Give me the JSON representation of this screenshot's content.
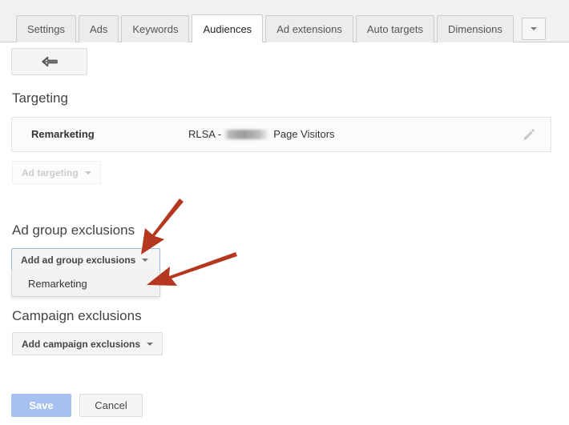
{
  "tabbar": {
    "tabs": [
      {
        "label": "Settings",
        "active": false
      },
      {
        "label": "Ads",
        "active": false
      },
      {
        "label": "Keywords",
        "active": false
      },
      {
        "label": "Audiences",
        "active": true
      },
      {
        "label": "Ad extensions",
        "active": false
      },
      {
        "label": "Auto targets",
        "active": false
      },
      {
        "label": "Dimensions",
        "active": false
      }
    ],
    "more_icon": "chevron-down-icon"
  },
  "back_button": {
    "icon": "back-arrow-icon",
    "label": ""
  },
  "targeting": {
    "heading": "Targeting",
    "row": {
      "label": "Remarketing",
      "value_prefix": "RLSA - ",
      "value_redacted": true,
      "value_suffix": "Page Visitors",
      "edit_icon": "pencil-icon"
    },
    "ad_targeting_button": {
      "label": "Ad targeting",
      "disabled": true,
      "caret": "chevron-down-icon"
    }
  },
  "ad_group_exclusions": {
    "heading": "Ad group exclusions",
    "add_button": {
      "label": "Add ad group exclusions",
      "focused": true,
      "caret": "chevron-down-icon"
    },
    "menu_items": [
      {
        "label": "Remarketing"
      }
    ]
  },
  "campaign_exclusions": {
    "heading": "Campaign exclusions",
    "add_button": {
      "label": "Add campaign exclusions",
      "caret": "chevron-down-icon"
    }
  },
  "footer": {
    "save_label": "Save",
    "cancel_label": "Cancel"
  },
  "colors": {
    "tabbar_background": "#f1f1f1",
    "active_tab": "#ffffff",
    "button_face": "#f5f5f5",
    "focus_border": "#9fb6e0",
    "save_blue": "#a6c0f0",
    "annotation_arrow": "#b5371f",
    "menu_background": "#f2f2f2",
    "text": "#333333"
  },
  "annotations": {
    "arrows": [
      {
        "name": "arrow-to-add-ad-group-exclusions-button",
        "color": "#b5371f"
      },
      {
        "name": "arrow-to-remarketing-menu-item",
        "color": "#b5371f"
      }
    ]
  }
}
